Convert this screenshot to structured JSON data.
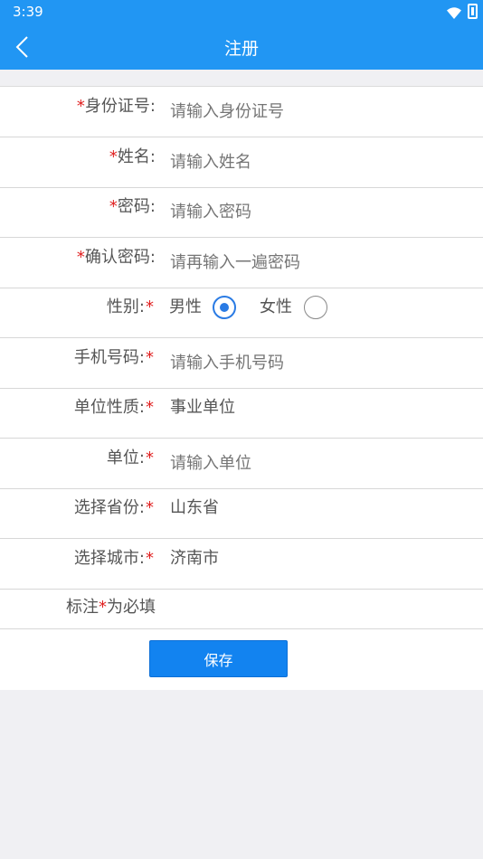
{
  "status_bar": {
    "time": "3:39",
    "wifi_icon": "wifi-icon",
    "battery_icon": "battery-icon"
  },
  "app_bar": {
    "title": "注册",
    "back_icon": "chevron-left-icon"
  },
  "colors": {
    "primary": "#2196f3",
    "required_star": "#e02020",
    "button": "#1283f0"
  },
  "fields": {
    "id_number": {
      "label": "身份证号:",
      "placeholder": "请输入身份证号"
    },
    "name": {
      "label": "姓名:",
      "placeholder": "请输入姓名"
    },
    "password": {
      "label": "密码:",
      "placeholder": "请输入密码"
    },
    "confirm_password": {
      "label": "确认密码:",
      "placeholder": "请再输入一遍密码"
    },
    "gender": {
      "label": "性别:",
      "options": [
        "男性",
        "女性"
      ],
      "selected": "男性"
    },
    "phone": {
      "label": "手机号码:",
      "placeholder": "请输入手机号码"
    },
    "unit_type": {
      "label": "单位性质:",
      "value": "事业单位"
    },
    "unit": {
      "label": "单位:",
      "placeholder": "请输入单位"
    },
    "province": {
      "label": "选择省份:",
      "value": "山东省"
    },
    "city": {
      "label": "选择城市:",
      "value": "济南市"
    }
  },
  "required_mark": "*",
  "note": {
    "prefix": "标注",
    "star": "*",
    "suffix": "为必填"
  },
  "save_button": "保存"
}
